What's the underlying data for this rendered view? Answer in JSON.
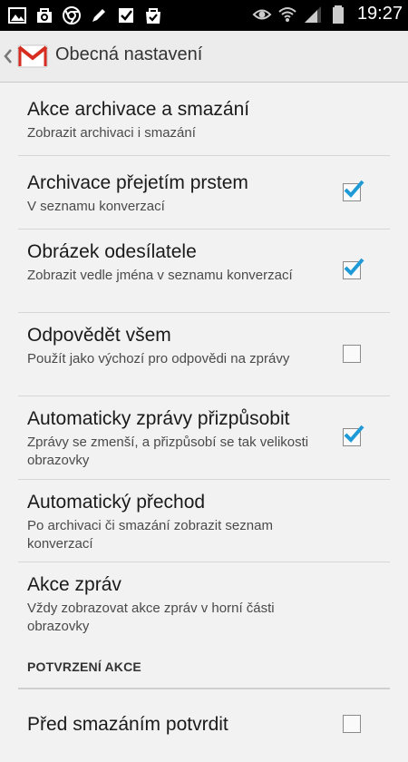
{
  "status_bar": {
    "time": "19:27",
    "left_icons": [
      "image-icon",
      "photo-bag-icon",
      "chrome-icon",
      "pen-icon",
      "checklist-icon",
      "shopping-bag-check-icon"
    ],
    "right_icons": [
      "eye-icon",
      "wifi-icon",
      "signal-icon",
      "battery-icon"
    ]
  },
  "action_bar": {
    "title": "Obecná nastavení",
    "app_icon": "gmail-icon"
  },
  "settings": [
    {
      "title": "Akce archivace a smazání",
      "subtitle": "Zobrazit archivaci i smazání",
      "checkbox": null
    },
    {
      "title": "Archivace přejetím prstem",
      "subtitle": "V seznamu konverzací",
      "checkbox": true
    },
    {
      "title": "Obrázek odesílatele",
      "subtitle": "Zobrazit vedle jména v seznamu konverzací",
      "checkbox": true
    },
    {
      "title": "Odpovědět všem",
      "subtitle": "Použít jako výchozí pro odpovědi na zprávy",
      "checkbox": false
    },
    {
      "title": "Automaticky zprávy přizpůsobit",
      "subtitle": "Zprávy se zmenší, a přizpůsobí se tak velikosti obrazovky",
      "checkbox": true
    },
    {
      "title": "Automatický přechod",
      "subtitle": "Po archivaci či smazání zobrazit seznam konverzací",
      "checkbox": null
    },
    {
      "title": "Akce zpráv",
      "subtitle": "Vždy zobrazovat akce zpráv v horní části obrazovky",
      "checkbox": null
    }
  ],
  "section_confirm": {
    "header": "POTVRZENÍ AKCE",
    "items": [
      {
        "title": "Před smazáním potvrdit",
        "checkbox": false
      }
    ]
  },
  "colors": {
    "checkmark": "#1e9ad6",
    "gmail_red": "#d62d20",
    "background": "#f2f2f2"
  }
}
